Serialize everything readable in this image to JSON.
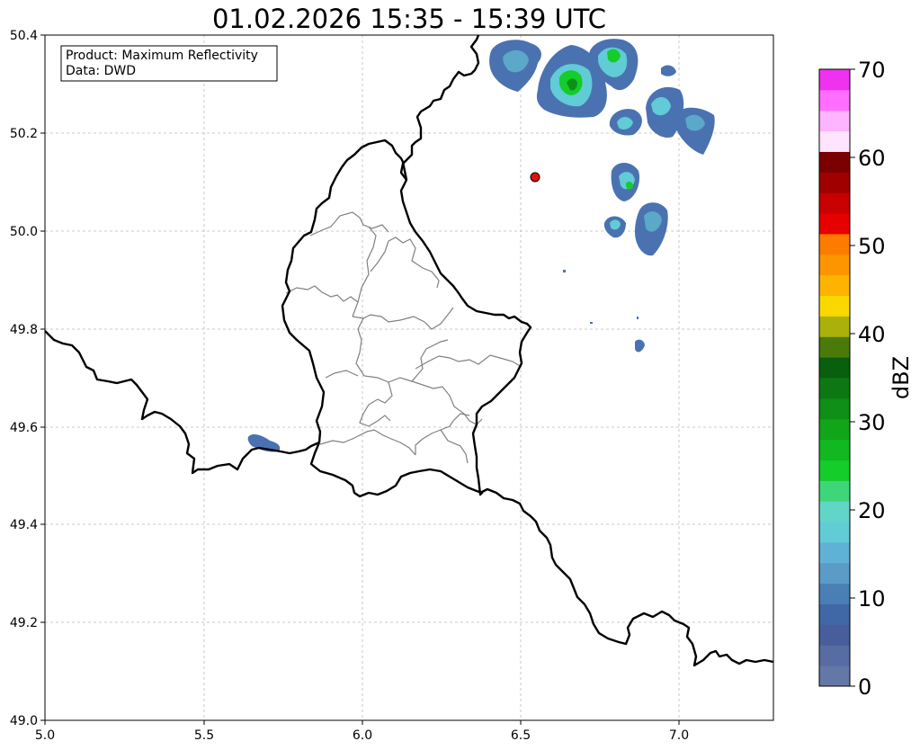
{
  "title": "01.02.2026 15:35 - 15:39 UTC",
  "info_box": {
    "product_line": "Product: Maximum Reflectivity",
    "data_line": "Data: DWD"
  },
  "axes": {
    "x_ticks": [
      "5.0",
      "5.5",
      "6.0",
      "6.5",
      "7.0"
    ],
    "y_ticks": [
      "50.4",
      "50.2",
      "50.0",
      "49.8",
      "49.6",
      "49.4",
      "49.2",
      "49.0"
    ],
    "lon_range": [
      5.0,
      7.3
    ],
    "lat_range": [
      49.0,
      50.4
    ],
    "grid": true
  },
  "colorbar": {
    "unit": "dBZ",
    "range": [
      0,
      70
    ],
    "tick_labels": [
      "0",
      "10",
      "20",
      "30",
      "40",
      "50",
      "60",
      "70"
    ],
    "colors": [
      "#6478a8",
      "#566ca2",
      "#485e9c",
      "#4068a6",
      "#4a7fb5",
      "#5b9bc8",
      "#5fb2d6",
      "#61cbd6",
      "#61d6c8",
      "#3fd67a",
      "#14cc2a",
      "#11b81f",
      "#11a51a",
      "#0e8f16",
      "#0d7813",
      "#0a5f0f",
      "#4a7a0a",
      "#aab10a",
      "#f9d800",
      "#fcb400",
      "#fd9500",
      "#fd7c00",
      "#e60000",
      "#c80000",
      "#a00000",
      "#7a0000",
      "#ffe4ff",
      "#ffb4ff",
      "#ff6eff",
      "#f032f0"
    ]
  },
  "marker": {
    "lon": 6.55,
    "lat": 50.11,
    "color": "#e01010"
  }
}
